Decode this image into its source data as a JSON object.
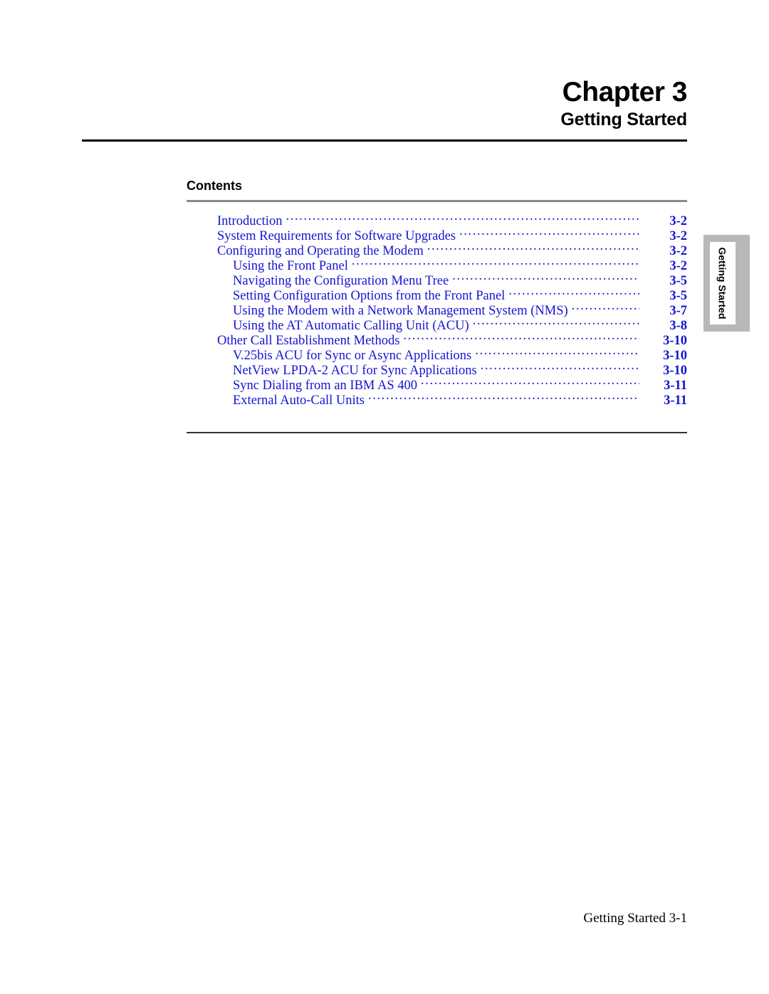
{
  "header": {
    "chapter_title": "Chapter 3",
    "chapter_subtitle": "Getting Started"
  },
  "contents": {
    "heading": "Contents",
    "entries": [
      {
        "label": "Introduction",
        "page": "3-2",
        "level": 1
      },
      {
        "label": "System Requirements for Software Upgrades",
        "page": "3-2",
        "level": 1
      },
      {
        "label": "Configuring and Operating the Modem",
        "page": "3-2",
        "level": 1
      },
      {
        "label": "Using the Front Panel",
        "page": "3-2",
        "level": 2
      },
      {
        "label": "Navigating the Configuration Menu Tree",
        "page": "3-5",
        "level": 2
      },
      {
        "label": "Setting Configuration Options from the Front Panel",
        "page": "3-5",
        "level": 2
      },
      {
        "label": "Using the Modem with a Network Management System (NMS)",
        "page": "3-7",
        "level": 2
      },
      {
        "label": "Using the AT Automatic Calling Unit (ACU)",
        "page": "3-8",
        "level": 2
      },
      {
        "label": "Other Call Establishment Methods",
        "page": "3-10",
        "level": 1
      },
      {
        "label": "V.25bis ACU for Sync or Async Applications",
        "page": "3-10",
        "level": 2
      },
      {
        "label": "NetView LPDA-2 ACU for Sync Applications",
        "page": "3-10",
        "level": 2
      },
      {
        "label": "Sync Dialing from an IBM AS 400",
        "page": "3-11",
        "level": 2
      },
      {
        "label": "External Auto-Call Units",
        "page": "3-11",
        "level": 2
      }
    ]
  },
  "side_tab": {
    "label": "Getting Started"
  },
  "footer": {
    "text": "Getting Started 3-1"
  },
  "colors": {
    "toc_link": "#1414d2",
    "rule_gray": "#8a8a8a",
    "rule_dark": "#333333",
    "side_tab_bg": "#b8b8b8"
  }
}
